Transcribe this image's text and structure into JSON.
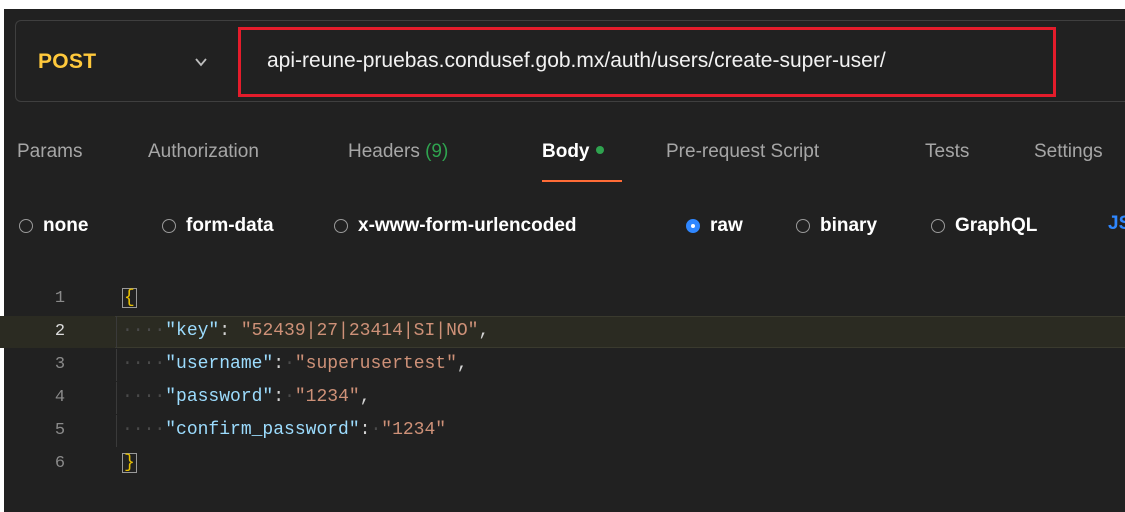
{
  "request": {
    "method": "POST",
    "url": "api-reune-pruebas.condusef.gob.mx/auth/users/create-super-user/"
  },
  "tabs": [
    {
      "label": "Params"
    },
    {
      "label": "Authorization"
    },
    {
      "label": "Headers",
      "count": "(9)"
    },
    {
      "label": "Body"
    },
    {
      "label": "Pre-request Script"
    },
    {
      "label": "Tests"
    },
    {
      "label": "Settings"
    }
  ],
  "active_tab": "Body",
  "body_types": [
    {
      "label": "none",
      "selected": false
    },
    {
      "label": "form-data",
      "selected": false
    },
    {
      "label": "x-www-form-urlencoded",
      "selected": false
    },
    {
      "label": "raw",
      "selected": true
    },
    {
      "label": "binary",
      "selected": false
    },
    {
      "label": "GraphQL",
      "selected": false
    }
  ],
  "body_type_overflow": "JS",
  "editor": {
    "active_line": 2,
    "lines": [
      {
        "num": "1",
        "open": "{"
      },
      {
        "num": "2",
        "key": "\"key\"",
        "value": "\"52439|27|23414|SI|NO\"",
        "trail": ","
      },
      {
        "num": "3",
        "key": "\"username\"",
        "value": "\"superusertest\"",
        "trail": ","
      },
      {
        "num": "4",
        "key": "\"password\"",
        "value": "\"1234\"",
        "trail": ","
      },
      {
        "num": "5",
        "key": "\"confirm_password\"",
        "value": "\"1234\"",
        "trail": ""
      },
      {
        "num": "6",
        "close": "}"
      }
    ]
  },
  "colors": {
    "method": "#ffc93c",
    "url_highlight_border": "#e41c2b",
    "tab_underline": "#ff6c37",
    "status_green": "#2fa34f",
    "radio_selected": "#2f87ff"
  }
}
